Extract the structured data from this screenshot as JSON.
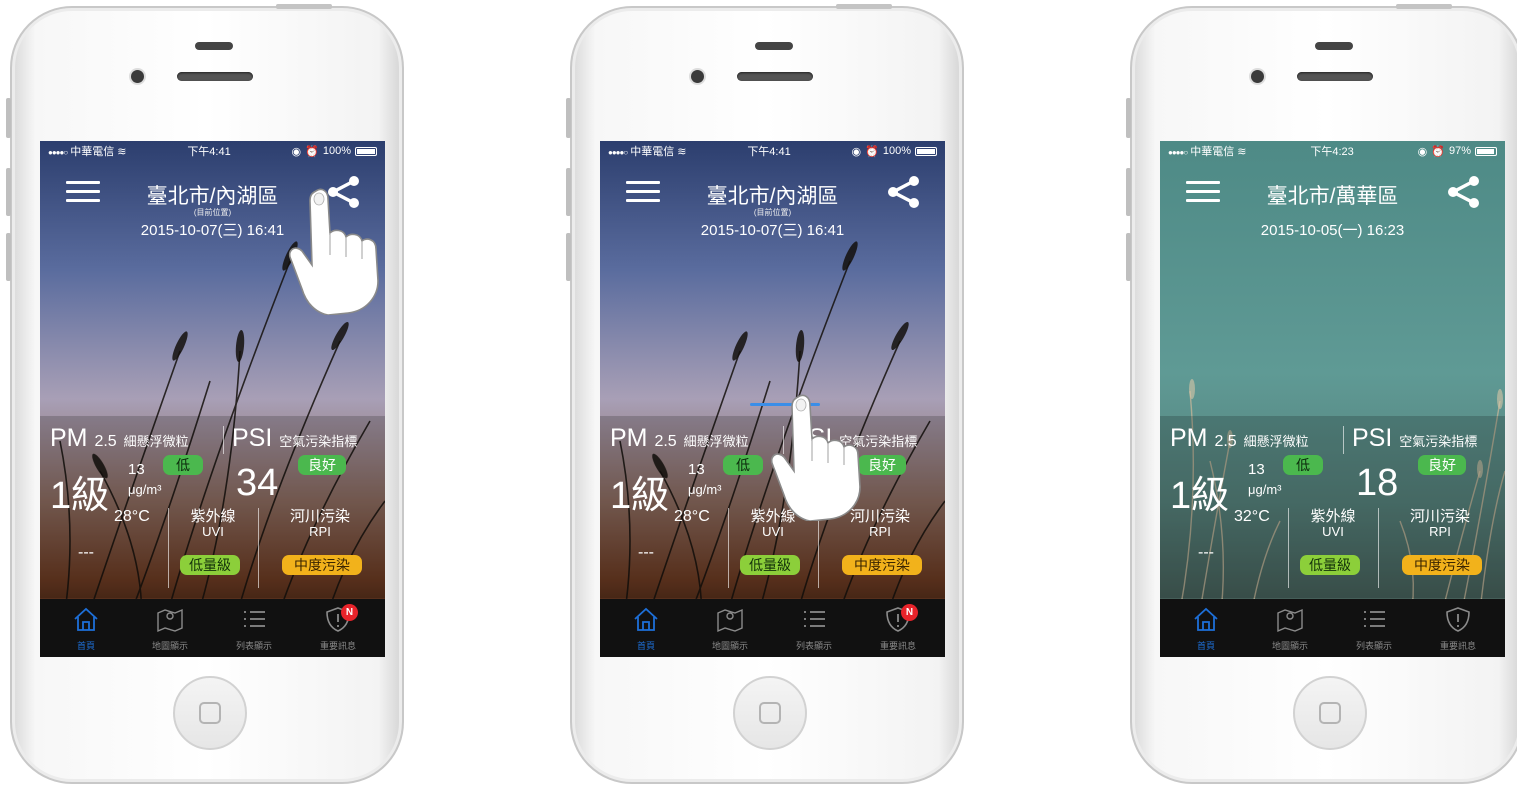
{
  "screens": [
    {
      "status": {
        "carrier": "中華電信",
        "time": "下午4:41",
        "battery": "100%",
        "battery_level": 1.0
      },
      "city": "臺北市/內湖區",
      "location_note": "(目前位置)",
      "datetime": "2015-10-07(三) 16:41",
      "pm_label": "PM",
      "pm_sub": "2.5",
      "pm_cn": "細懸浮微粒",
      "psi_label": "PSI",
      "psi_cn": "空氣污染指標",
      "pm_level": "1級",
      "pm_value": "13",
      "pm_unit": "μg/m³",
      "pm_badge": "低",
      "psi_value": "34",
      "psi_badge": "良好",
      "temperature": "28°C",
      "extra": "---",
      "uvi_title": "紫外線",
      "uvi_sub": "UVI",
      "uvi_badge": "低量級",
      "rpi_title": "河川污染",
      "rpi_sub": "RPI",
      "rpi_badge": "中度污染",
      "tabs": [
        "首頁",
        "地圖顯示",
        "列表顯示",
        "重要訊息"
      ],
      "notice_badge": "N",
      "theme": "dusk"
    },
    {
      "status": {
        "carrier": "中華電信",
        "time": "下午4:41",
        "battery": "100%",
        "battery_level": 1.0
      },
      "city": "臺北市/內湖區",
      "location_note": "(目前位置)",
      "datetime": "2015-10-07(三) 16:41",
      "pm_label": "PM",
      "pm_sub": "2.5",
      "pm_cn": "細懸浮微粒",
      "psi_label": "PSI",
      "psi_cn": "空氣污染指標",
      "pm_level": "1級",
      "pm_value": "13",
      "pm_unit": "μg/m³",
      "pm_badge": "低",
      "psi_value": "",
      "psi_badge": "良好",
      "temperature": "28°C",
      "extra": "---",
      "uvi_title": "紫外線",
      "uvi_sub": "UVI",
      "uvi_badge": "低量級",
      "rpi_title": "河川污染",
      "rpi_sub": "RPI",
      "rpi_badge": "中度污染",
      "tabs": [
        "首頁",
        "地圖顯示",
        "列表顯示",
        "重要訊息"
      ],
      "notice_badge": "N",
      "theme": "dusk"
    },
    {
      "status": {
        "carrier": "中華電信",
        "time": "下午4:23",
        "battery": "97%",
        "battery_level": 0.97
      },
      "city": "臺北市/萬華區",
      "location_note": "",
      "datetime": "2015-10-05(一) 16:23",
      "pm_label": "PM",
      "pm_sub": "2.5",
      "pm_cn": "細懸浮微粒",
      "psi_label": "PSI",
      "psi_cn": "空氣污染指標",
      "pm_level": "1級",
      "pm_value": "13",
      "pm_unit": "μg/m³",
      "pm_badge": "低",
      "psi_value": "18",
      "psi_badge": "良好",
      "temperature": "32°C",
      "extra": "---",
      "uvi_title": "紫外線",
      "uvi_sub": "UVI",
      "uvi_badge": "低量級",
      "rpi_title": "河川污染",
      "rpi_sub": "RPI",
      "rpi_badge": "中度污染",
      "tabs": [
        "首頁",
        "地圖顯示",
        "列表顯示",
        "重要訊息"
      ],
      "notice_badge": "",
      "theme": "teal"
    }
  ],
  "colors": {
    "tab_active": "#1d6fd8",
    "badge_green": "#4bb84e",
    "badge_yellow": "#f2b21b",
    "badge_lightgreen": "#8ccf3a",
    "notice_red": "#e8232a"
  }
}
